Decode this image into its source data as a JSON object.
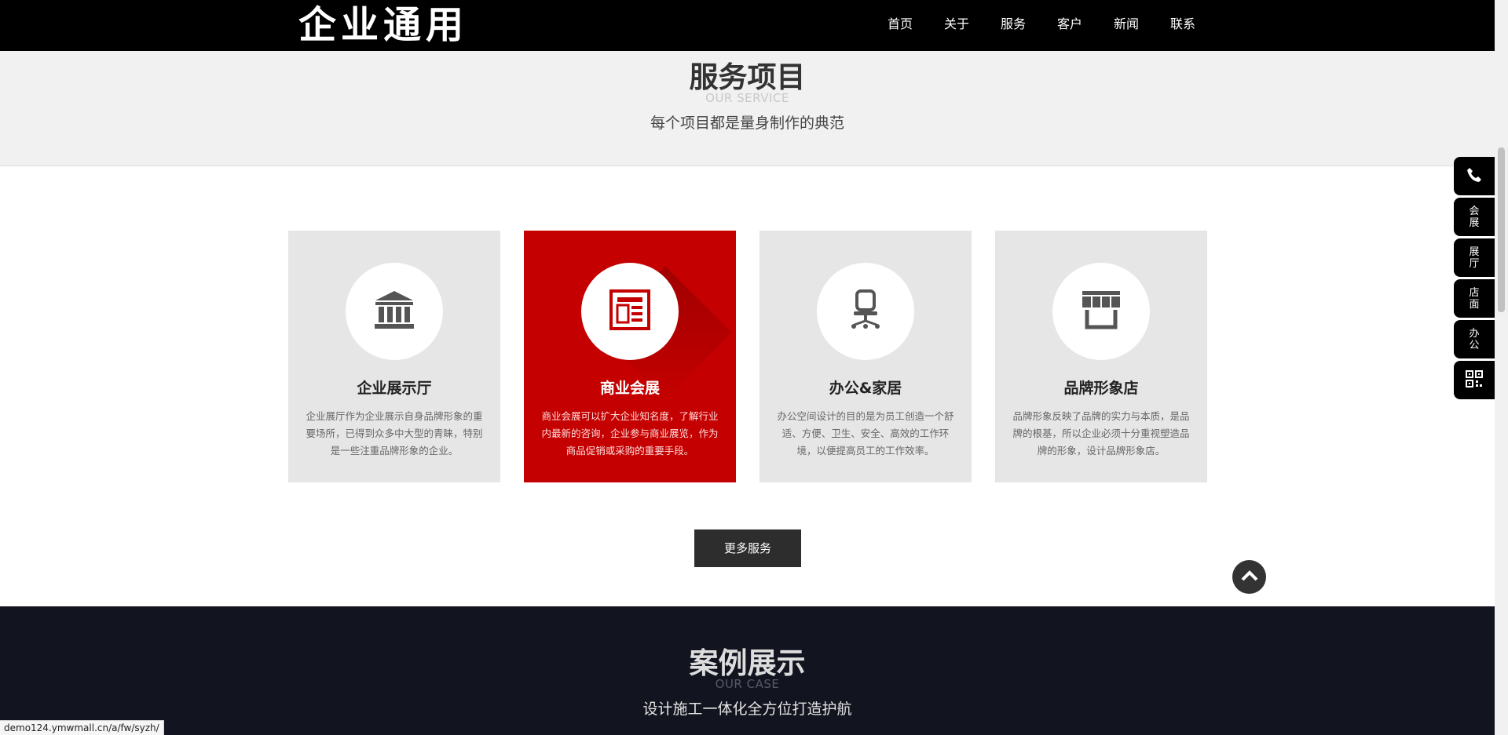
{
  "header": {
    "logo": "企业通用",
    "nav": [
      "首页",
      "关于",
      "服务",
      "客户",
      "新闻",
      "联系"
    ]
  },
  "service": {
    "title": "服务项目",
    "subtitle": "OUR SERVICE",
    "desc": "每个项目都是量身制作的典范",
    "cards": [
      {
        "icon": "bank-building-icon",
        "title": "企业展示厅",
        "text": "企业展厅作为企业展示自身品牌形象的重要场所，已得到众多中大型的青睐，特别是一些注重品牌形象的企业。"
      },
      {
        "icon": "newspaper-layout-icon",
        "title": "商业会展",
        "text": "商业会展可以扩大企业知名度，了解行业内最新的咨询，企业参与商业展览，作为商品促销或采购的重要手段。"
      },
      {
        "icon": "office-chair-icon",
        "title": "办公&家居",
        "text": "办公空间设计的目的是为员工创造一个舒适、方便、卫生、安全、高效的工作环境，以便提高员工的工作效率。"
      },
      {
        "icon": "storefront-icon",
        "title": "品牌形象店",
        "text": "品牌形象反映了品牌的实力与本质，是品牌的根基，所以企业必须十分重视塑造品牌的形象，设计品牌形象店。"
      }
    ],
    "more_label": "更多服务"
  },
  "case": {
    "title": "案例展示",
    "subtitle": "OUR CASE",
    "desc": "设计施工一体化全方位打造护航"
  },
  "sidebar": {
    "items": [
      "会展",
      "展厅",
      "店面",
      "办公"
    ]
  },
  "status_url": "demo124.ymwmall.cn/a/fw/syzh/",
  "colors": {
    "accent": "#c40000",
    "header": "#000000",
    "case_bg": "#12141f",
    "card_bg": "#e6e6e6"
  }
}
